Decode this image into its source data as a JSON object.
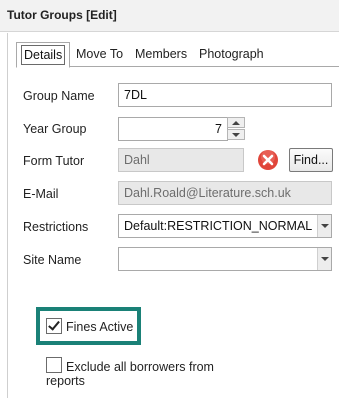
{
  "window": {
    "title": "Tutor Groups [Edit]"
  },
  "tabs": [
    {
      "label": "Details",
      "active": true
    },
    {
      "label": "Move To"
    },
    {
      "label": "Members"
    },
    {
      "label": "Photograph"
    }
  ],
  "form": {
    "group_name": {
      "label": "Group Name",
      "value": "7DL"
    },
    "year_group": {
      "label": "Year Group",
      "value": "7"
    },
    "form_tutor": {
      "label": "Form Tutor",
      "value": "Dahl",
      "clear_icon": "clear-red-x-icon",
      "find_label": "Find..."
    },
    "email": {
      "label": "E-Mail",
      "value": "Dahl.Roald@Literature.sch.uk"
    },
    "restrictions": {
      "label": "Restrictions",
      "value": "Default:RESTRICTION_NORMAL"
    },
    "site_name": {
      "label": "Site Name",
      "value": ""
    }
  },
  "options": {
    "fines_active": {
      "label": "Fines Active",
      "checked": true
    },
    "exclude_borrowers": {
      "label_line1": "Exclude all borrowers from",
      "label_line2": "reports",
      "checked": false
    }
  },
  "colors": {
    "highlight": "#1a8177",
    "clear_icon": "#e0453a"
  }
}
